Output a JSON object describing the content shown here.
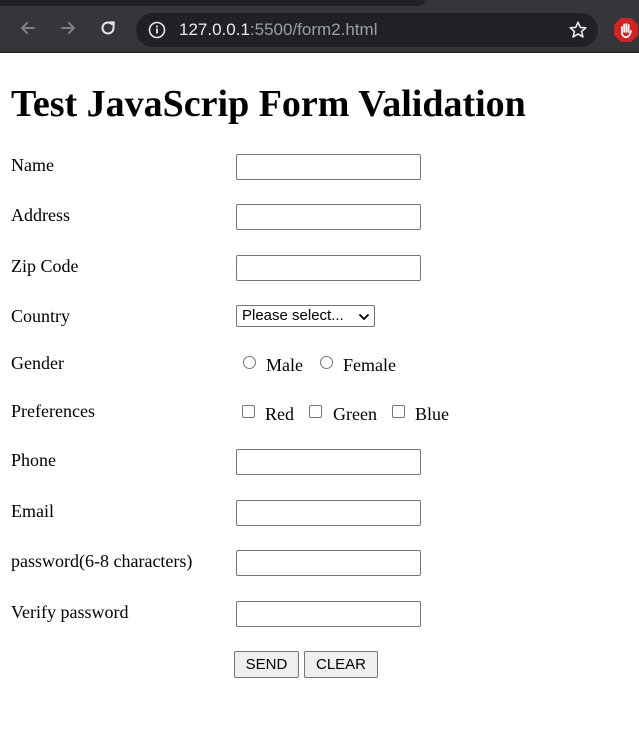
{
  "browser": {
    "url_host": "127.0.0.1",
    "url_rest": ":5500/form2.html"
  },
  "page": {
    "title": "Test JavaScrip Form Validation"
  },
  "form": {
    "name_label": "Name",
    "address_label": "Address",
    "zip_label": "Zip Code",
    "country_label": "Country",
    "country_select": {
      "selected": "Please select..."
    },
    "gender_label": "Gender",
    "gender_options": [
      "Male",
      "Female"
    ],
    "preferences_label": "Preferences",
    "preference_options": [
      "Red",
      "Green",
      "Blue"
    ],
    "phone_label": "Phone",
    "email_label": "Email",
    "password_label": "password(6-8 characters)",
    "verify_label": "Verify password",
    "send_label": "SEND",
    "clear_label": "CLEAR"
  }
}
